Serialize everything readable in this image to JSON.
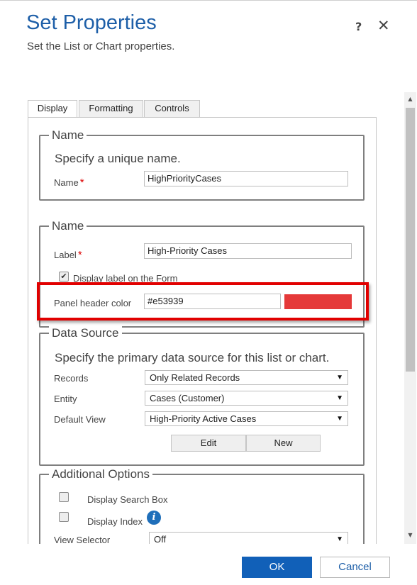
{
  "dialog": {
    "title": "Set Properties",
    "subtitle": "Set the List or Chart properties.",
    "help_label": "?",
    "close_label": "✕"
  },
  "tabs": [
    {
      "label": "Display"
    },
    {
      "label": "Formatting"
    },
    {
      "label": "Controls"
    }
  ],
  "name_section": {
    "legend": "Name",
    "description": "Specify a unique name.",
    "name_label": "Name",
    "required_mark": "*",
    "name_value": "HighPriorityCases"
  },
  "label_section": {
    "legend": "Name",
    "label_label": "Label",
    "required_mark": "*",
    "label_value": "High-Priority Cases",
    "display_label_checkbox": "Display label on the Form",
    "display_label_checked": true,
    "panel_header_color_label": "Panel header color",
    "panel_header_color_value": "#e53939",
    "swatch_color": "#e53939"
  },
  "data_source": {
    "legend": "Data Source",
    "description": "Specify the primary data source for this list or chart.",
    "records_label": "Records",
    "records_value": "Only Related Records",
    "entity_label": "Entity",
    "entity_value": "Cases (Customer)",
    "default_view_label": "Default View",
    "default_view_value": "High-Priority Active Cases",
    "edit_label": "Edit",
    "new_label": "New"
  },
  "additional_options": {
    "legend": "Additional Options",
    "search_box_label": "Display Search Box",
    "search_box_checked": false,
    "display_index_label": "Display Index",
    "display_index_checked": false,
    "view_selector_label": "View Selector",
    "view_selector_value": "Off"
  },
  "footer": {
    "ok_label": "OK",
    "cancel_label": "Cancel"
  },
  "colors": {
    "title_blue": "#1e5fa8",
    "primary_button": "#1160b8",
    "highlight_red": "#e10000",
    "swatch": "#e53939"
  },
  "icons": {
    "dropdown": "chevron-down-icon",
    "info": "info-icon",
    "check": "checkmark-icon"
  },
  "glyphs": {
    "dropdown_arrow": "▼",
    "scroll_up": "▲",
    "scroll_down": "▼",
    "check": "✔",
    "info": "i"
  }
}
